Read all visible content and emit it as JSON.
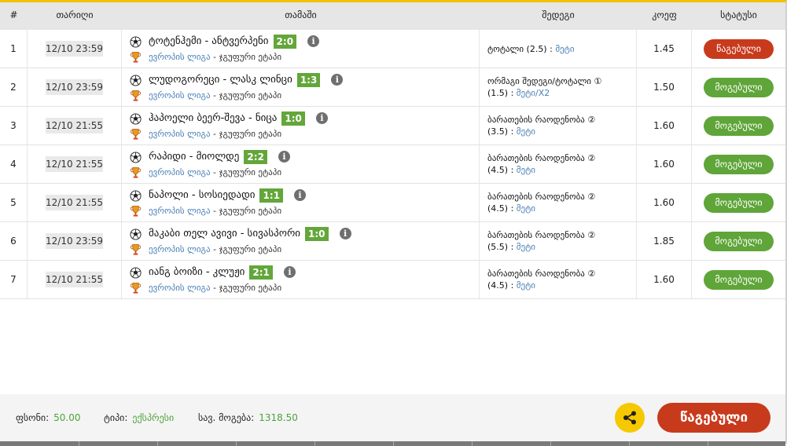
{
  "headers": {
    "num": "#",
    "date": "თარიღი",
    "game": "თამაში",
    "bet": "შედეგი",
    "coef": "კოეფ",
    "status": "სტატუსი"
  },
  "rows": [
    {
      "num": "1",
      "date": "12/10 23:59",
      "teams": "ტოტენჰემი - ანტვერპენი",
      "score": "2:0",
      "league": "ევროპის ლიგა",
      "stage": " - ჯგუფური ეტაპი",
      "bet_lines": [
        "ტოტალი (2.5) : "
      ],
      "pick": "მეტი",
      "coef": "1.45",
      "status": "წაგებული",
      "status_type": "lost"
    },
    {
      "num": "2",
      "date": "12/10 23:59",
      "teams": "ლუდოგორეცი - ლასკ ლინცი",
      "score": "1:3",
      "league": "ევროპის ლიგა",
      "stage": " - ჯგუფური ეტაპი",
      "bet_lines": [
        "ორმაგი შედეგი/ტოტალი ①",
        "(1.5) : "
      ],
      "pick": "მეტი/X2",
      "coef": "1.50",
      "status": "მოგებული",
      "status_type": "won"
    },
    {
      "num": "3",
      "date": "12/10 21:55",
      "teams": "ჰაპოელი ბეერ-შევა - ნიცა",
      "score": "1:0",
      "league": "ევროპის ლიგა",
      "stage": " - ჯგუფური ეტაპი",
      "bet_lines": [
        "ბარათების რაოდენობა ②",
        "(3.5) : "
      ],
      "pick": "მეტი",
      "coef": "1.60",
      "status": "მოგებული",
      "status_type": "won"
    },
    {
      "num": "4",
      "date": "12/10 21:55",
      "teams": "რაპიდი - მიოლდე",
      "score": "2:2",
      "league": "ევროპის ლიგა",
      "stage": " - ჯგუფური ეტაპი",
      "bet_lines": [
        "ბარათების რაოდენობა ②",
        "(4.5) : "
      ],
      "pick": "მეტი",
      "coef": "1.60",
      "status": "მოგებული",
      "status_type": "won"
    },
    {
      "num": "5",
      "date": "12/10 21:55",
      "teams": "ნაპოლი - სოსიედადი",
      "score": "1:1",
      "league": "ევროპის ლიგა",
      "stage": " - ჯგუფური ეტაპი",
      "bet_lines": [
        "ბარათების რაოდენობა ②",
        "(4.5) : "
      ],
      "pick": "მეტი",
      "coef": "1.60",
      "status": "მოგებული",
      "status_type": "won"
    },
    {
      "num": "6",
      "date": "12/10 23:59",
      "teams": "მაკაბი თელ ავივი - სივასპორი",
      "score": "1:0",
      "league": "ევროპის ლიგა",
      "stage": " - ჯგუფური ეტაპი",
      "bet_lines": [
        "ბარათების რაოდენობა ②",
        "(5.5) : "
      ],
      "pick": "მეტი",
      "coef": "1.85",
      "status": "მოგებული",
      "status_type": "won"
    },
    {
      "num": "7",
      "date": "12/10 21:55",
      "teams": "იანგ ბოიზი - კლუჟი",
      "score": "2:1",
      "league": "ევროპის ლიგა",
      "stage": " - ჯგუფური ეტაპი",
      "bet_lines": [
        "ბარათების რაოდენობა ②",
        "(4.5) : "
      ],
      "pick": "მეტი",
      "coef": "1.60",
      "status": "მოგებული",
      "status_type": "won"
    }
  ],
  "footer": {
    "stake_label": "ფსონი:",
    "stake_value": "50.00",
    "type_label": "ტიპი:",
    "type_value": "ექსპრესი",
    "total_label": "სავ. მოგება:",
    "total_value": "1318.50",
    "result_button": "წაგებული"
  },
  "colors": {
    "won": "#5fa539",
    "lost": "#c83a1c",
    "accent": "#f6c800",
    "link": "#4a7fb5"
  },
  "icons": {
    "ball": "soccer-ball-icon",
    "cup": "europa-league-icon",
    "info": "info-icon",
    "share": "share-icon"
  }
}
